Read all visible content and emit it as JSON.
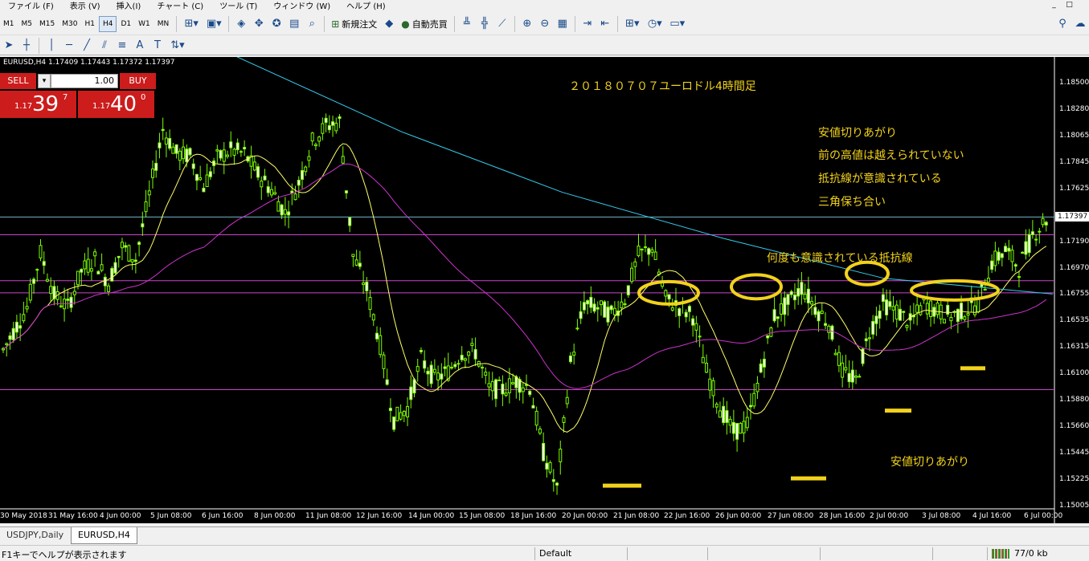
{
  "menubar": {
    "items": [
      "ファイル (F)",
      "表示 (V)",
      "挿入(I)",
      "チャート (C)",
      "ツール (T)",
      "ウィンドウ (W)",
      "ヘルプ (H)"
    ],
    "window_controls": [
      "_",
      "□"
    ]
  },
  "toolbar": {
    "timeframes": [
      "M1",
      "M5",
      "M15",
      "M30",
      "H1",
      "H4",
      "D1",
      "W1",
      "MN"
    ],
    "active_timeframe": "H4",
    "new_order_label": "新規注文",
    "autotrade_label": "自動売買"
  },
  "drawing_toolbar": {
    "tools": [
      "cursor-tool",
      "crosshair-tool",
      "vertical-line-tool",
      "horizontal-line-tool",
      "trendline-tool",
      "channel-tool",
      "fibo-tool",
      "text-tool",
      "label-tool",
      "arrows-tool"
    ],
    "text_tool_glyph": "A",
    "label_tool_glyph": "T"
  },
  "chart": {
    "symbol_header": "EURUSD,H4  1.17409 1.17443 1.17372 1.17397",
    "trade_panel": {
      "sell_label": "SELL",
      "buy_label": "BUY",
      "lot": "1.00",
      "sell_price_prefix": "1.17",
      "sell_price_big": "39",
      "sell_price_sup": "7",
      "buy_price_prefix": "1.17",
      "buy_price_big": "40",
      "buy_price_sup": "0"
    },
    "current_price": "1.17397",
    "annotations": {
      "title": "２０１８０７０７ユーロドル4時間足",
      "note1": "安値切りあがり",
      "note2": "前の高値は越えられていない",
      "note3": "抵抗線が意識されている",
      "note4": "三角保ち合い",
      "resistance_note": "何度も意識されている抵抗線",
      "bottom_note": "安値切りあがり"
    },
    "colors": {
      "background": "#000000",
      "candle": "#7cfc00",
      "ma_fast": "#ffff66",
      "ma_mid": "#cc33cc",
      "ma_slow": "#33ccee",
      "hline": "#cc44cc",
      "annotation": "#f2d21c"
    }
  },
  "chart_data": {
    "type": "candlestick",
    "symbol": "EURUSD",
    "timeframe": "H4",
    "ohlc_last": {
      "open": 1.17409,
      "high": 1.17443,
      "low": 1.17372,
      "close": 1.17397
    },
    "y_ticks": [
      "1.18500",
      "1.18280",
      "1.18065",
      "1.17845",
      "1.17625",
      "1.17397",
      "1.17190",
      "1.16970",
      "1.16755",
      "1.16535",
      "1.16315",
      "1.16100",
      "1.15880",
      "1.15660",
      "1.15445",
      "1.15225",
      "1.15005"
    ],
    "x_ticks": [
      "30 May 2018",
      "31 May 16:00",
      "4 Jun 00:00",
      "5 Jun 08:00",
      "6 Jun 16:00",
      "8 Jun 00:00",
      "11 Jun 08:00",
      "12 Jun 16:00",
      "14 Jun 00:00",
      "15 Jun 08:00",
      "18 Jun 16:00",
      "20 Jun 00:00",
      "21 Jun 08:00",
      "22 Jun 16:00",
      "26 Jun 00:00",
      "27 Jun 08:00",
      "28 Jun 16:00",
      "2 Jul 00:00",
      "3 Jul 08:00",
      "4 Jul 16:00",
      "6 Jul 00:00"
    ],
    "ylim": [
      1.15005,
      1.185
    ],
    "horizontal_lines": [
      1.17397,
      1.1725,
      1.1687,
      1.1677,
      1.1597
    ],
    "closes_approx": [
      1.1645,
      1.1665,
      1.171,
      1.1675,
      1.1665,
      1.1695,
      1.1705,
      1.1685,
      1.1715,
      1.1705,
      1.1758,
      1.1812,
      1.1792,
      1.179,
      1.1765,
      1.1788,
      1.1795,
      1.1792,
      1.1775,
      1.1762,
      1.1743,
      1.1768,
      1.1802,
      1.1815,
      1.1818,
      1.1708,
      1.168,
      1.1634,
      1.1572,
      1.1582,
      1.1622,
      1.1606,
      1.1612,
      1.1628,
      1.1628,
      1.1598,
      1.1597,
      1.1604,
      1.1599,
      1.1545,
      1.1515,
      1.1619,
      1.1668,
      1.1665,
      1.1659,
      1.1672,
      1.1708,
      1.1715,
      1.1672,
      1.1665,
      1.1658,
      1.1612,
      1.1582,
      1.1562,
      1.1568,
      1.1612,
      1.1658,
      1.1668,
      1.1682,
      1.1665,
      1.1652,
      1.1612,
      1.1604,
      1.1645,
      1.1668,
      1.1662,
      1.1652,
      1.1668,
      1.1662,
      1.1658,
      1.1662,
      1.1668,
      1.1702,
      1.1712,
      1.1698,
      1.1725,
      1.1738
    ]
  },
  "tabs": [
    "USDJPY,Daily",
    "EURUSD,H4"
  ],
  "active_tab": "EURUSD,H4",
  "statusbar": {
    "help": "F1キーでヘルプが表示されます",
    "profile": "Default",
    "traffic": "77/0 kb"
  }
}
